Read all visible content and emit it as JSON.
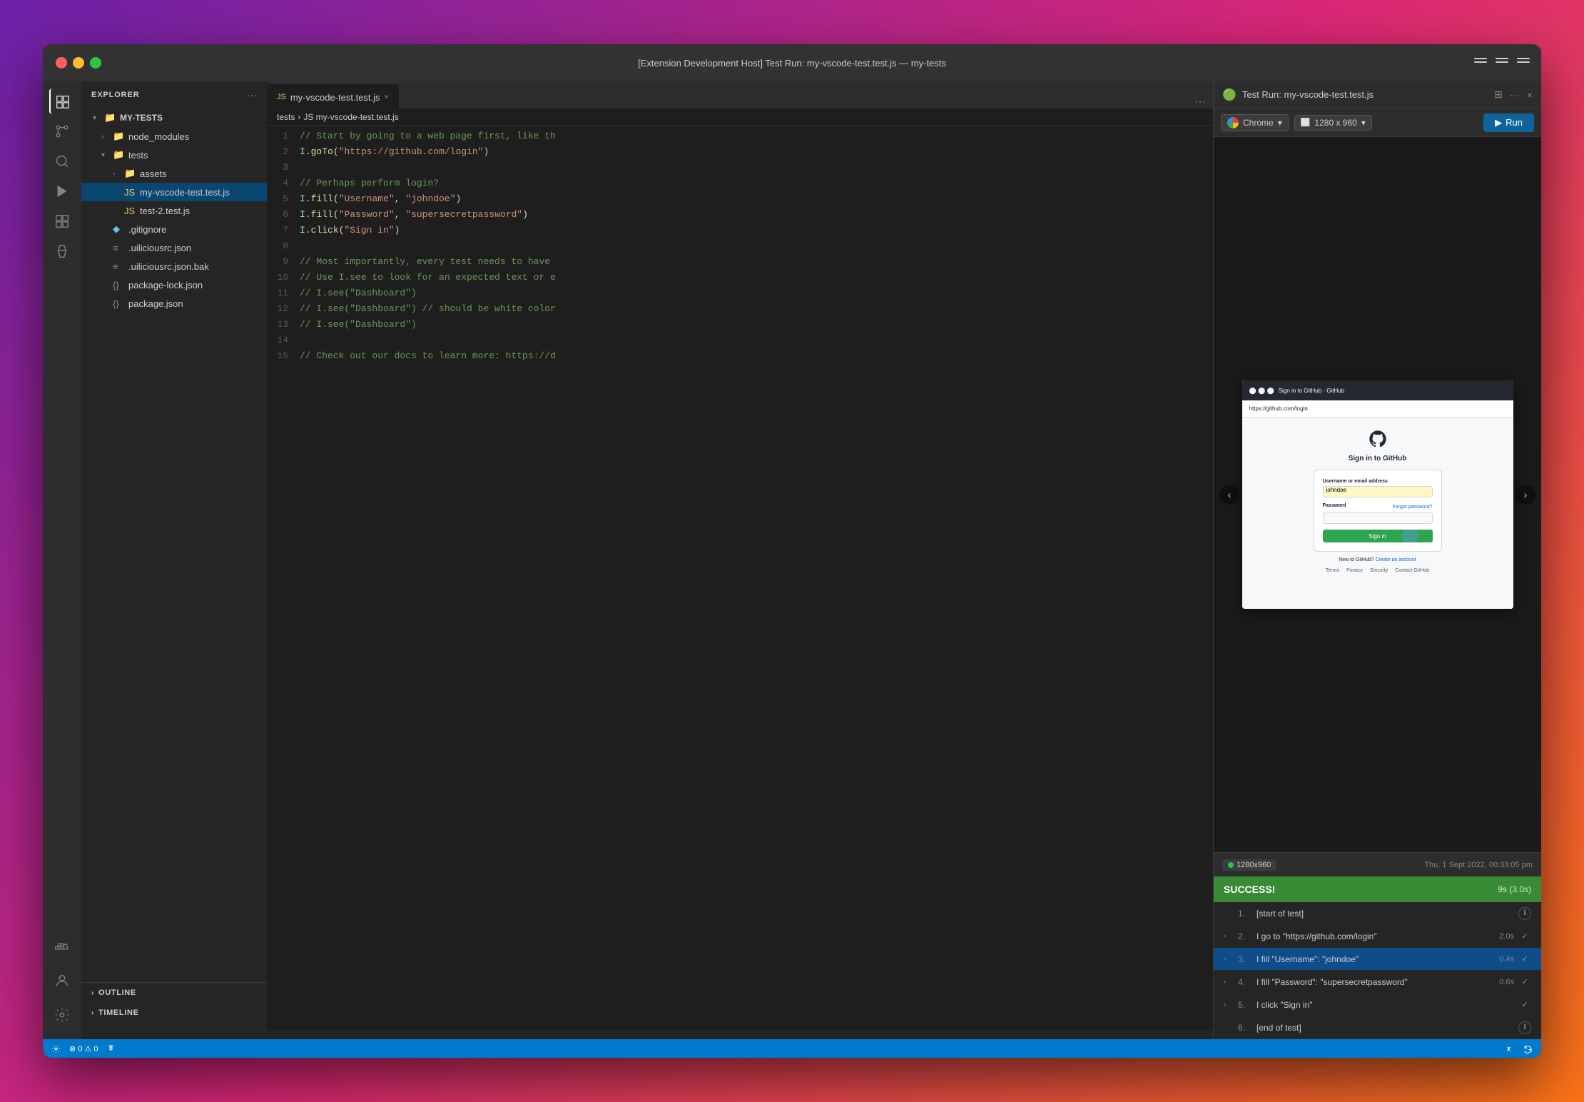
{
  "window": {
    "title": "[Extension Development Host] Test Run: my-vscode-test.test.js — my-tests",
    "traffic": {
      "close_label": "close",
      "minimize_label": "minimize",
      "maximize_label": "maximize"
    }
  },
  "sidebar": {
    "header": "EXPLORER",
    "more_icon": "...",
    "tree": {
      "root": "MY-TESTS",
      "items": [
        {
          "id": "node_modules",
          "label": "node_modules",
          "type": "folder",
          "indent": 1,
          "expanded": false
        },
        {
          "id": "tests",
          "label": "tests",
          "type": "folder",
          "indent": 1,
          "expanded": true
        },
        {
          "id": "assets",
          "label": "assets",
          "type": "folder",
          "indent": 2,
          "expanded": false
        },
        {
          "id": "my-vscode-test.test.js",
          "label": "my-vscode-test.test.js",
          "type": "js",
          "indent": 2,
          "selected": true
        },
        {
          "id": "test-2.test.js",
          "label": "test-2.test.js",
          "type": "js",
          "indent": 2
        },
        {
          "id": ".gitignore",
          "label": ".gitignore",
          "type": "git",
          "indent": 1
        },
        {
          "id": ".uiliciousrc.json",
          "label": ".uiliciousrc.json",
          "type": "json",
          "indent": 1
        },
        {
          "id": ".uiliciousrc.json.bak",
          "label": ".uiliciousrc.json.bak",
          "type": "json",
          "indent": 1
        },
        {
          "id": "package-lock.json",
          "label": "package-lock.json",
          "type": "json",
          "indent": 1
        },
        {
          "id": "package.json",
          "label": "package.json",
          "type": "json",
          "indent": 1
        }
      ]
    },
    "outline_label": "OUTLINE",
    "timeline_label": "TIMELINE"
  },
  "editor": {
    "tab": {
      "filename": "my-vscode-test.test.js",
      "close_icon": "×"
    },
    "breadcrumb": {
      "parts": [
        "tests",
        "my-vscode-test.test.js"
      ]
    },
    "lines": [
      {
        "num": 1,
        "content": "comment",
        "text": "// Start by going to a web page first, like th"
      },
      {
        "num": 2,
        "content": "code",
        "text": "I.goTo(\"https://github.com/login\")"
      },
      {
        "num": 3,
        "content": "blank",
        "text": ""
      },
      {
        "num": 4,
        "content": "comment",
        "text": "// Perhaps perform login?"
      },
      {
        "num": 5,
        "content": "code",
        "text": "I.fill(\"Username\", \"johndoe\")"
      },
      {
        "num": 6,
        "content": "code",
        "text": "I.fill(\"Password\", \"supersecretpassword\")"
      },
      {
        "num": 7,
        "content": "code",
        "text": "I.click(\"Sign in\")"
      },
      {
        "num": 8,
        "content": "blank",
        "text": ""
      },
      {
        "num": 9,
        "content": "comment",
        "text": "// Most importantly, every test needs to have"
      },
      {
        "num": 10,
        "content": "comment",
        "text": "// Use I.see to look for an expected text or e"
      },
      {
        "num": 11,
        "content": "comment",
        "text": "// I.see(\"Dashboard\")"
      },
      {
        "num": 12,
        "content": "comment",
        "text": "// I.see(\"Dashboard\") // should be white color"
      },
      {
        "num": 13,
        "content": "comment",
        "text": "// I.see(\"Dashboard\")"
      },
      {
        "num": 14,
        "content": "blank",
        "text": ""
      },
      {
        "num": 15,
        "content": "comment",
        "text": "// Check out our docs to learn more: https://d"
      }
    ]
  },
  "test_panel": {
    "title": "Test Run: my-vscode-test.test.js",
    "close_icon": "×",
    "split_icon": "⊞",
    "more_icon": "...",
    "toolbar": {
      "browser": "Chrome",
      "browser_dropdown": "▾",
      "resolution": "1280 x 960",
      "resolution_dropdown": "▾",
      "run_label": "Run",
      "run_icon": "▶"
    },
    "screenshot": {
      "url": "https://github.com/login",
      "page_title": "Sign in to GitHub · GitHub",
      "github_heading": "Sign in to GitHub",
      "username_label": "Username or email address",
      "username_value": "johndoe",
      "password_label": "Password",
      "forgot_label": "Forgot password?",
      "signin_btn": "Sign in",
      "new_account": "New to GitHub?",
      "create_account": "Create an account",
      "footer_links": [
        "Terms",
        "Privacy",
        "Security",
        "Contact GitHub"
      ]
    },
    "metadata": {
      "resolution": "1280x960",
      "timestamp": "Thu, 1 Sept 2022, 00:33:05 pm"
    },
    "success": {
      "label": "SUCCESS!",
      "time": "9s (3.0s)"
    },
    "test_steps": [
      {
        "num": "1.",
        "desc": "[start of test]",
        "duration": "",
        "status": "info",
        "expanded": false
      },
      {
        "num": "2.",
        "desc": "I go to \"https://github.com/login\"",
        "duration": "2.0s",
        "status": "success",
        "expanded": false
      },
      {
        "num": "3.",
        "desc": "I fill \"Username\": \"johndoe\"",
        "duration": "0.4s",
        "status": "success",
        "highlighted": true
      },
      {
        "num": "4.",
        "desc": "I fill \"Password\": \"supersecretpassword\"",
        "duration": "0.6s",
        "status": "success",
        "expanded": false
      },
      {
        "num": "5.",
        "desc": "I click \"Sign in\"",
        "duration": "",
        "status": "success",
        "expanded": false
      },
      {
        "num": "6.",
        "desc": "[end of test]",
        "duration": "",
        "status": "info",
        "expanded": false
      }
    ]
  },
  "status_bar": {
    "left_items": [
      {
        "id": "settings-icon",
        "text": "⚙",
        "label": "settings"
      },
      {
        "id": "errors",
        "text": "⊗ 0  ⚠ 0",
        "label": "errors warnings"
      },
      {
        "id": "broadcast",
        "text": "⊕",
        "label": "broadcast"
      }
    ],
    "right_items": [
      {
        "id": "remote-icon",
        "text": "⇄",
        "label": "remote"
      },
      {
        "id": "refresh-icon",
        "text": "↻",
        "label": "refresh"
      }
    ]
  }
}
